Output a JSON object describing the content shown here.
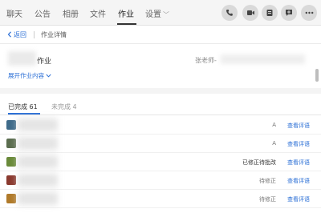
{
  "tabs": [
    {
      "label": "聊天",
      "active": false
    },
    {
      "label": "公告",
      "active": false
    },
    {
      "label": "相册",
      "active": false
    },
    {
      "label": "文件",
      "active": false
    },
    {
      "label": "作业",
      "active": true
    },
    {
      "label": "设置",
      "active": false
    }
  ],
  "toolbar_icons": [
    "phone-icon",
    "video-icon",
    "screen-share-icon",
    "add-message-icon",
    "more-icon"
  ],
  "breadcrumb": {
    "back": "返回",
    "current": "作业详情"
  },
  "homework": {
    "name": "作业",
    "teacher": "张老师-",
    "expand": "展开作业内容"
  },
  "subtabs": {
    "done": "已完成 61",
    "undone": "未完成 4"
  },
  "submissions": [
    {
      "status": "A",
      "action": "查看评语",
      "avatar_color": "#3f6b8a"
    },
    {
      "status": "A",
      "action": "查看评语",
      "avatar_color": "#5b6d4f"
    },
    {
      "status": "已修正待批改",
      "action": "查看评语",
      "avatar_color": "#6a8a3a"
    },
    {
      "status": "待修正",
      "action": "查看评语",
      "avatar_color": "#8a3a2f"
    },
    {
      "status": "待修正",
      "action": "查看评语",
      "avatar_color": "#b07a2a"
    }
  ],
  "colors": {
    "accent": "#2b6fd6",
    "icon_bg": "#d9d9d9"
  }
}
